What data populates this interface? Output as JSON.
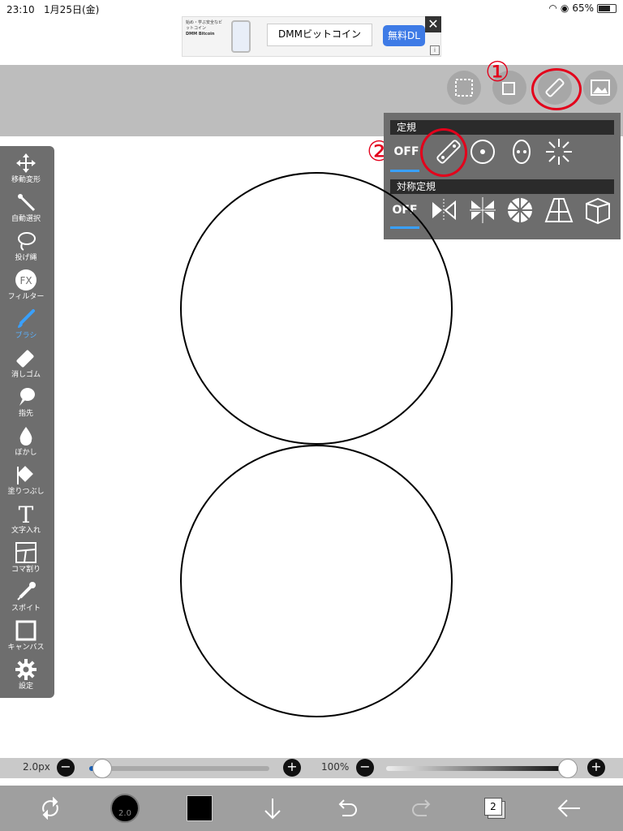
{
  "status": {
    "time": "23:10",
    "date": "1月25日(金)",
    "battery": "65%"
  },
  "ad": {
    "mini_text": "始め・学ぶ安全なビットコイン",
    "brand": "DMM Bitcoin",
    "title": "DMMビットコイン",
    "cta": "無料DL",
    "close": "✕",
    "info": "i"
  },
  "annotations": {
    "one": "①",
    "two": "②"
  },
  "ruler": {
    "header1": "定規",
    "header2": "対称定規",
    "off": "OFF"
  },
  "tools": [
    {
      "label": "移動変形",
      "icon": "move-icon"
    },
    {
      "label": "自動選択",
      "icon": "magic-wand-icon"
    },
    {
      "label": "投げ縄",
      "icon": "lasso-icon"
    },
    {
      "label": "フィルター",
      "icon": "fx-icon"
    },
    {
      "label": "ブラシ",
      "icon": "brush-icon"
    },
    {
      "label": "消しゴム",
      "icon": "eraser-icon"
    },
    {
      "label": "指先",
      "icon": "finger-icon"
    },
    {
      "label": "ぼかし",
      "icon": "blur-icon"
    },
    {
      "label": "塗りつぶし",
      "icon": "fill-icon"
    },
    {
      "label": "文字入れ",
      "icon": "text-icon"
    },
    {
      "label": "コマ割り",
      "icon": "frame-icon"
    },
    {
      "label": "スポイト",
      "icon": "eyedropper-icon"
    },
    {
      "label": "キャンバス",
      "icon": "canvas-icon"
    },
    {
      "label": "設定",
      "icon": "gear-icon"
    }
  ],
  "sliders": {
    "size_label": "2.0px",
    "size_fraction": 0.02,
    "opacity_label": "100%",
    "opacity_fraction": 1.0,
    "minus": "−",
    "plus": "+"
  },
  "bottom": {
    "brush_size": "2.0",
    "layer_count": "2"
  },
  "colors": {
    "accent": "#39a0ff",
    "annotation": "#e3001b",
    "current_color": "#000000"
  }
}
